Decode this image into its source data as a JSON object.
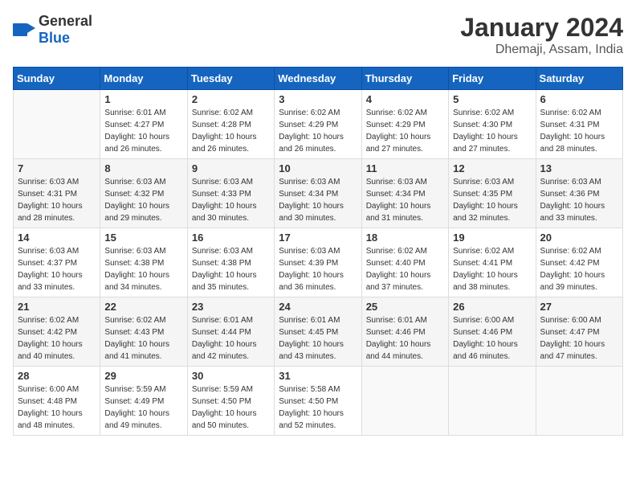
{
  "header": {
    "logo_general": "General",
    "logo_blue": "Blue",
    "title": "January 2024",
    "location": "Dhemaji, Assam, India"
  },
  "days_of_week": [
    "Sunday",
    "Monday",
    "Tuesday",
    "Wednesday",
    "Thursday",
    "Friday",
    "Saturday"
  ],
  "weeks": [
    [
      {
        "day": "",
        "sunrise": "",
        "sunset": "",
        "daylight": ""
      },
      {
        "day": "1",
        "sunrise": "Sunrise: 6:01 AM",
        "sunset": "Sunset: 4:27 PM",
        "daylight": "Daylight: 10 hours and 26 minutes."
      },
      {
        "day": "2",
        "sunrise": "Sunrise: 6:02 AM",
        "sunset": "Sunset: 4:28 PM",
        "daylight": "Daylight: 10 hours and 26 minutes."
      },
      {
        "day": "3",
        "sunrise": "Sunrise: 6:02 AM",
        "sunset": "Sunset: 4:29 PM",
        "daylight": "Daylight: 10 hours and 26 minutes."
      },
      {
        "day": "4",
        "sunrise": "Sunrise: 6:02 AM",
        "sunset": "Sunset: 4:29 PM",
        "daylight": "Daylight: 10 hours and 27 minutes."
      },
      {
        "day": "5",
        "sunrise": "Sunrise: 6:02 AM",
        "sunset": "Sunset: 4:30 PM",
        "daylight": "Daylight: 10 hours and 27 minutes."
      },
      {
        "day": "6",
        "sunrise": "Sunrise: 6:02 AM",
        "sunset": "Sunset: 4:31 PM",
        "daylight": "Daylight: 10 hours and 28 minutes."
      }
    ],
    [
      {
        "day": "7",
        "sunrise": "Sunrise: 6:03 AM",
        "sunset": "Sunset: 4:31 PM",
        "daylight": "Daylight: 10 hours and 28 minutes."
      },
      {
        "day": "8",
        "sunrise": "Sunrise: 6:03 AM",
        "sunset": "Sunset: 4:32 PM",
        "daylight": "Daylight: 10 hours and 29 minutes."
      },
      {
        "day": "9",
        "sunrise": "Sunrise: 6:03 AM",
        "sunset": "Sunset: 4:33 PM",
        "daylight": "Daylight: 10 hours and 30 minutes."
      },
      {
        "day": "10",
        "sunrise": "Sunrise: 6:03 AM",
        "sunset": "Sunset: 4:34 PM",
        "daylight": "Daylight: 10 hours and 30 minutes."
      },
      {
        "day": "11",
        "sunrise": "Sunrise: 6:03 AM",
        "sunset": "Sunset: 4:34 PM",
        "daylight": "Daylight: 10 hours and 31 minutes."
      },
      {
        "day": "12",
        "sunrise": "Sunrise: 6:03 AM",
        "sunset": "Sunset: 4:35 PM",
        "daylight": "Daylight: 10 hours and 32 minutes."
      },
      {
        "day": "13",
        "sunrise": "Sunrise: 6:03 AM",
        "sunset": "Sunset: 4:36 PM",
        "daylight": "Daylight: 10 hours and 33 minutes."
      }
    ],
    [
      {
        "day": "14",
        "sunrise": "Sunrise: 6:03 AM",
        "sunset": "Sunset: 4:37 PM",
        "daylight": "Daylight: 10 hours and 33 minutes."
      },
      {
        "day": "15",
        "sunrise": "Sunrise: 6:03 AM",
        "sunset": "Sunset: 4:38 PM",
        "daylight": "Daylight: 10 hours and 34 minutes."
      },
      {
        "day": "16",
        "sunrise": "Sunrise: 6:03 AM",
        "sunset": "Sunset: 4:38 PM",
        "daylight": "Daylight: 10 hours and 35 minutes."
      },
      {
        "day": "17",
        "sunrise": "Sunrise: 6:03 AM",
        "sunset": "Sunset: 4:39 PM",
        "daylight": "Daylight: 10 hours and 36 minutes."
      },
      {
        "day": "18",
        "sunrise": "Sunrise: 6:02 AM",
        "sunset": "Sunset: 4:40 PM",
        "daylight": "Daylight: 10 hours and 37 minutes."
      },
      {
        "day": "19",
        "sunrise": "Sunrise: 6:02 AM",
        "sunset": "Sunset: 4:41 PM",
        "daylight": "Daylight: 10 hours and 38 minutes."
      },
      {
        "day": "20",
        "sunrise": "Sunrise: 6:02 AM",
        "sunset": "Sunset: 4:42 PM",
        "daylight": "Daylight: 10 hours and 39 minutes."
      }
    ],
    [
      {
        "day": "21",
        "sunrise": "Sunrise: 6:02 AM",
        "sunset": "Sunset: 4:42 PM",
        "daylight": "Daylight: 10 hours and 40 minutes."
      },
      {
        "day": "22",
        "sunrise": "Sunrise: 6:02 AM",
        "sunset": "Sunset: 4:43 PM",
        "daylight": "Daylight: 10 hours and 41 minutes."
      },
      {
        "day": "23",
        "sunrise": "Sunrise: 6:01 AM",
        "sunset": "Sunset: 4:44 PM",
        "daylight": "Daylight: 10 hours and 42 minutes."
      },
      {
        "day": "24",
        "sunrise": "Sunrise: 6:01 AM",
        "sunset": "Sunset: 4:45 PM",
        "daylight": "Daylight: 10 hours and 43 minutes."
      },
      {
        "day": "25",
        "sunrise": "Sunrise: 6:01 AM",
        "sunset": "Sunset: 4:46 PM",
        "daylight": "Daylight: 10 hours and 44 minutes."
      },
      {
        "day": "26",
        "sunrise": "Sunrise: 6:00 AM",
        "sunset": "Sunset: 4:46 PM",
        "daylight": "Daylight: 10 hours and 46 minutes."
      },
      {
        "day": "27",
        "sunrise": "Sunrise: 6:00 AM",
        "sunset": "Sunset: 4:47 PM",
        "daylight": "Daylight: 10 hours and 47 minutes."
      }
    ],
    [
      {
        "day": "28",
        "sunrise": "Sunrise: 6:00 AM",
        "sunset": "Sunset: 4:48 PM",
        "daylight": "Daylight: 10 hours and 48 minutes."
      },
      {
        "day": "29",
        "sunrise": "Sunrise: 5:59 AM",
        "sunset": "Sunset: 4:49 PM",
        "daylight": "Daylight: 10 hours and 49 minutes."
      },
      {
        "day": "30",
        "sunrise": "Sunrise: 5:59 AM",
        "sunset": "Sunset: 4:50 PM",
        "daylight": "Daylight: 10 hours and 50 minutes."
      },
      {
        "day": "31",
        "sunrise": "Sunrise: 5:58 AM",
        "sunset": "Sunset: 4:50 PM",
        "daylight": "Daylight: 10 hours and 52 minutes."
      },
      {
        "day": "",
        "sunrise": "",
        "sunset": "",
        "daylight": ""
      },
      {
        "day": "",
        "sunrise": "",
        "sunset": "",
        "daylight": ""
      },
      {
        "day": "",
        "sunrise": "",
        "sunset": "",
        "daylight": ""
      }
    ]
  ]
}
